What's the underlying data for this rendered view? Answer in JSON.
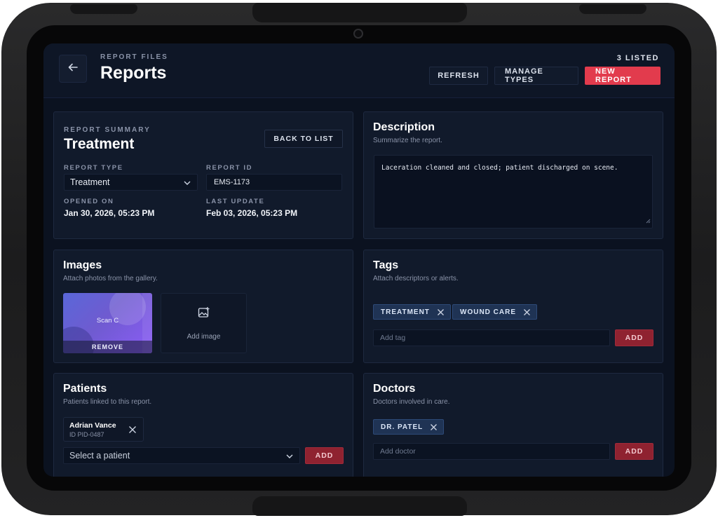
{
  "header": {
    "eyebrow": "REPORT FILES",
    "title": "Reports",
    "count_label": "3 LISTED",
    "buttons": {
      "refresh": "REFRESH",
      "manage_types": "MANAGE TYPES",
      "new_report": "NEW REPORT"
    }
  },
  "summary": {
    "eyebrow": "REPORT SUMMARY",
    "title": "Treatment",
    "back_label": "BACK TO LIST",
    "report_type_label": "REPORT TYPE",
    "report_type_value": "Treatment",
    "report_id_label": "REPORT ID",
    "report_id_value": "EMS-1173",
    "opened_label": "OPENED ON",
    "opened_value": "Jan 30, 2026, 05:23 PM",
    "updated_label": "LAST UPDATE",
    "updated_value": "Feb 03, 2026, 05:23 PM"
  },
  "description": {
    "title": "Description",
    "subtitle": "Summarize the report.",
    "text": "Laceration cleaned and closed; patient discharged on scene."
  },
  "images": {
    "title": "Images",
    "subtitle": "Attach photos from the gallery.",
    "items": [
      {
        "label": "Scan C",
        "remove_label": "REMOVE"
      }
    ],
    "add_label": "Add image"
  },
  "tags": {
    "title": "Tags",
    "subtitle": "Attach descriptors or alerts.",
    "items": [
      "TREATMENT",
      "WOUND CARE"
    ],
    "input_placeholder": "Add tag",
    "add_label": "ADD"
  },
  "patients": {
    "title": "Patients",
    "subtitle": "Patients linked to this report.",
    "items": [
      {
        "name": "Adrian Vance",
        "id": "ID PID-0487"
      }
    ],
    "select_placeholder": "Select a patient",
    "add_label": "ADD"
  },
  "doctors": {
    "title": "Doctors",
    "subtitle": "Doctors involved in care.",
    "items": [
      "DR. PATEL"
    ],
    "input_placeholder": "Add doctor",
    "add_label": "ADD"
  },
  "colors": {
    "screen_bg": "#0b1220",
    "panel_bg": "#111a2b",
    "accent_red": "#e23b4d",
    "add_button": "#8f2230",
    "chip_bg": "#1f3354",
    "image_gradient": "#6f5bd0"
  },
  "icons": {
    "back": "arrow-left-icon",
    "dropdown": "chevron-down-icon",
    "remove": "close-icon",
    "add_image": "image-plus-icon"
  }
}
